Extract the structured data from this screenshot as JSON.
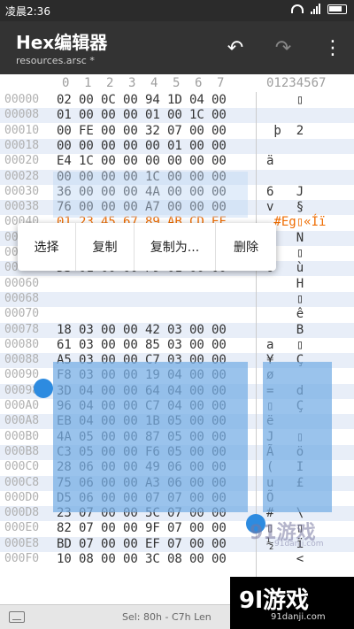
{
  "status": {
    "time": "凌晨2:36"
  },
  "app": {
    "title": "Hex编辑器",
    "subtitle": "resources.arsc *"
  },
  "icons": {
    "undo": "undo-icon",
    "redo": "redo-icon",
    "more": "more-vert-icon",
    "keyboard": "keyboard-icon"
  },
  "columns": {
    "hex": [
      "0",
      "1",
      "2",
      "3",
      "4",
      "5",
      "6",
      "7"
    ],
    "ascii": "01234567"
  },
  "rows": [
    {
      "addr": "00000",
      "hex": [
        "02",
        "00",
        "0C",
        "00",
        "94",
        "1D",
        "04",
        "00"
      ],
      "ascii": "    ▯"
    },
    {
      "addr": "00008",
      "hex": [
        "01",
        "00",
        "00",
        "00",
        "01",
        "00",
        "1C",
        "00"
      ],
      "ascii": ""
    },
    {
      "addr": "00010",
      "hex": [
        "00",
        "FE",
        "00",
        "00",
        "32",
        "07",
        "00",
        "00"
      ],
      "ascii": " þ  2"
    },
    {
      "addr": "00018",
      "hex": [
        "00",
        "00",
        "00",
        "00",
        "00",
        "01",
        "00",
        "00"
      ],
      "ascii": ""
    },
    {
      "addr": "00020",
      "hex": [
        "E4",
        "1C",
        "00",
        "00",
        "00",
        "00",
        "00",
        "00"
      ],
      "ascii": "ä"
    },
    {
      "addr": "00028",
      "hex": [
        "00",
        "00",
        "00",
        "00",
        "1C",
        "00",
        "00",
        "00"
      ],
      "ascii": ""
    },
    {
      "addr": "00030",
      "hex": [
        "36",
        "00",
        "00",
        "00",
        "4A",
        "00",
        "00",
        "00"
      ],
      "ascii": "6   J"
    },
    {
      "addr": "00038",
      "hex": [
        "76",
        "00",
        "00",
        "00",
        "A7",
        "00",
        "00",
        "00"
      ],
      "ascii": "v   §"
    },
    {
      "addr": "00040",
      "hex": [
        "01",
        "23",
        "45",
        "67",
        "89",
        "AB",
        "CD",
        "EF"
      ],
      "ascii": " #Eg▯«Íï"
    },
    {
      "addr": "00048",
      "hex": [
        "2B",
        "01",
        "00",
        "00",
        "4E",
        "01",
        "00",
        "00"
      ],
      "ascii": "+   N"
    },
    {
      "addr": "00050",
      "hex": [
        "7A",
        "01",
        "00",
        "00",
        "97",
        "01",
        "00",
        "00"
      ],
      "ascii": "z   ▯"
    },
    {
      "addr": "00058",
      "hex": [
        "D3",
        "01",
        "00",
        "00",
        "F9",
        "01",
        "00",
        "00"
      ],
      "ascii": "Ó   ù"
    },
    {
      "addr": "00060",
      "hex": [
        "",
        "",
        "",
        "",
        "",
        "",
        "",
        ""
      ],
      "ascii": "    H"
    },
    {
      "addr": "00068",
      "hex": [
        "",
        "",
        "",
        "",
        "",
        "",
        "",
        ""
      ],
      "ascii": "    ▯"
    },
    {
      "addr": "00070",
      "hex": [
        "",
        "",
        "",
        "",
        "",
        "",
        "",
        ""
      ],
      "ascii": "    ê"
    },
    {
      "addr": "00078",
      "hex": [
        "18",
        "03",
        "00",
        "00",
        "42",
        "03",
        "00",
        "00"
      ],
      "ascii": "    B"
    },
    {
      "addr": "00080",
      "hex": [
        "61",
        "03",
        "00",
        "00",
        "85",
        "03",
        "00",
        "00"
      ],
      "ascii": "a   ▯"
    },
    {
      "addr": "00088",
      "hex": [
        "A5",
        "03",
        "00",
        "00",
        "C7",
        "03",
        "00",
        "00"
      ],
      "ascii": "¥   Ç"
    },
    {
      "addr": "00090",
      "hex": [
        "F8",
        "03",
        "00",
        "00",
        "19",
        "04",
        "00",
        "00"
      ],
      "ascii": "ø"
    },
    {
      "addr": "00098",
      "hex": [
        "3D",
        "04",
        "00",
        "00",
        "64",
        "04",
        "00",
        "00"
      ],
      "ascii": "=   d"
    },
    {
      "addr": "000A0",
      "hex": [
        "96",
        "04",
        "00",
        "00",
        "C7",
        "04",
        "00",
        "00"
      ],
      "ascii": "▯   Ç"
    },
    {
      "addr": "000A8",
      "hex": [
        "EB",
        "04",
        "00",
        "00",
        "1B",
        "05",
        "00",
        "00"
      ],
      "ascii": "ë"
    },
    {
      "addr": "000B0",
      "hex": [
        "4A",
        "05",
        "00",
        "00",
        "87",
        "05",
        "00",
        "00"
      ],
      "ascii": "J   ▯"
    },
    {
      "addr": "000B8",
      "hex": [
        "C3",
        "05",
        "00",
        "00",
        "F6",
        "05",
        "00",
        "00"
      ],
      "ascii": "Ã   ö"
    },
    {
      "addr": "000C0",
      "hex": [
        "28",
        "06",
        "00",
        "00",
        "49",
        "06",
        "00",
        "00"
      ],
      "ascii": "(   I"
    },
    {
      "addr": "000C8",
      "hex": [
        "75",
        "06",
        "00",
        "00",
        "A3",
        "06",
        "00",
        "00"
      ],
      "ascii": "u   £"
    },
    {
      "addr": "000D0",
      "hex": [
        "D5",
        "06",
        "00",
        "00",
        "07",
        "07",
        "00",
        "00"
      ],
      "ascii": "Õ"
    },
    {
      "addr": "000D8",
      "hex": [
        "23",
        "07",
        "00",
        "00",
        "5C",
        "07",
        "00",
        "00"
      ],
      "ascii": "#   \\"
    },
    {
      "addr": "000E0",
      "hex": [
        "82",
        "07",
        "00",
        "00",
        "9F",
        "07",
        "00",
        "00"
      ],
      "ascii": "▯   ▯"
    },
    {
      "addr": "000E8",
      "hex": [
        "BD",
        "07",
        "00",
        "00",
        "EF",
        "07",
        "00",
        "00"
      ],
      "ascii": "½   ï"
    },
    {
      "addr": "000F0",
      "hex": [
        "10",
        "08",
        "00",
        "00",
        "3C",
        "08",
        "00",
        "00"
      ],
      "ascii": "    <"
    }
  ],
  "menu": {
    "items": [
      "选择",
      "复制",
      "复制为...",
      "删除"
    ]
  },
  "bottom": {
    "selection": "Sel: 80h - C7h  Len"
  },
  "watermark": {
    "main": "91游戏",
    "sub": "91danji.com"
  },
  "logo": {
    "main": "9l游戏",
    "sub": "91danji.com"
  },
  "colors": {
    "app_bar": "#333333",
    "selection": "#78afe6",
    "handle": "#2d8be0",
    "highlight_text": "#ef6c00"
  }
}
